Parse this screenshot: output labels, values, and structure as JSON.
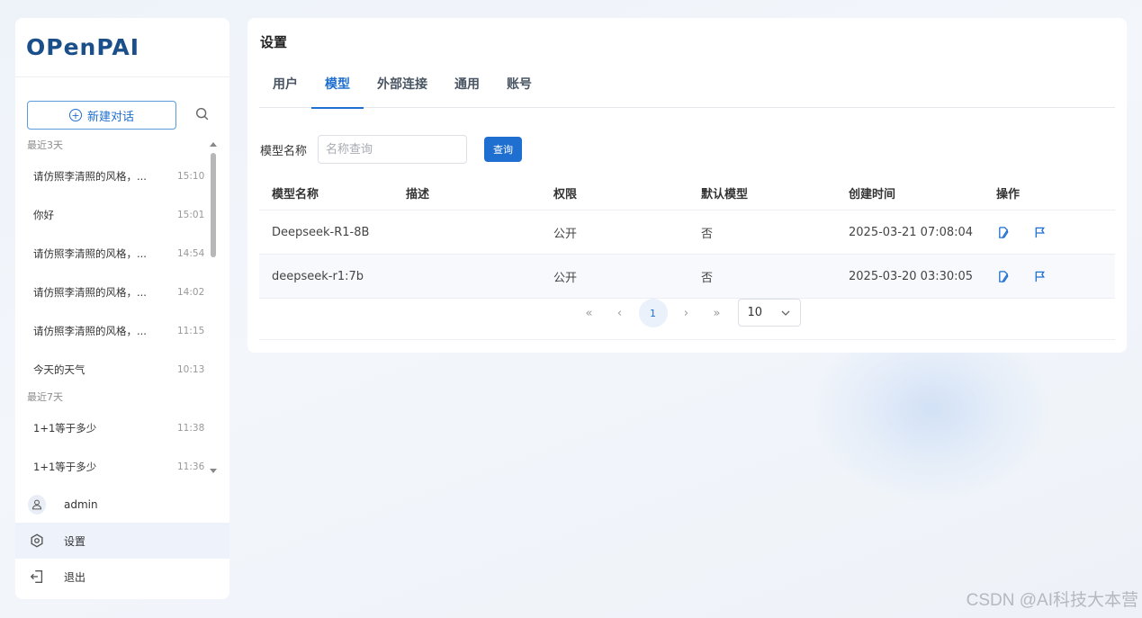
{
  "sidebar": {
    "logo": "OPenPAI",
    "new_chat_label": "新建对话",
    "groups": [
      {
        "title": "最近3天",
        "items": [
          {
            "text": "请仿照李清照的风格，...",
            "time": "15:10"
          },
          {
            "text": "你好",
            "time": "15:01"
          },
          {
            "text": "请仿照李清照的风格，...",
            "time": "14:54"
          },
          {
            "text": "请仿照李清照的风格，...",
            "time": "14:02"
          },
          {
            "text": "请仿照李清照的风格，...",
            "time": "11:15"
          },
          {
            "text": "今天的天气",
            "time": "10:13"
          }
        ]
      },
      {
        "title": "最近7天",
        "items": [
          {
            "text": "1+1等于多少",
            "time": "11:38"
          },
          {
            "text": "1+1等于多少",
            "time": "11:36"
          }
        ]
      }
    ],
    "menu": {
      "user": "admin",
      "settings": "设置",
      "logout": "退出"
    }
  },
  "main": {
    "title": "设置",
    "tabs": [
      "用户",
      "模型",
      "外部连接",
      "通用",
      "账号"
    ],
    "active_tab": "模型",
    "filter": {
      "label": "模型名称",
      "placeholder": "名称查询",
      "query_button": "查询"
    },
    "table": {
      "columns": [
        "模型名称",
        "描述",
        "权限",
        "默认模型",
        "创建时间",
        "操作"
      ],
      "rows": [
        {
          "name": "Deepseek-R1-8B",
          "desc": "",
          "permission": "公开",
          "default": "否",
          "created": "2025-03-21 07:08:04"
        },
        {
          "name": "deepseek-r1:7b",
          "desc": "",
          "permission": "公开",
          "default": "否",
          "created": "2025-03-20 03:30:05"
        }
      ]
    },
    "pagination": {
      "first": "«",
      "prev": "‹",
      "current": "1",
      "next": "›",
      "last": "»",
      "page_size": "10"
    }
  },
  "watermark": "CSDN @AI科技大本营",
  "colors": {
    "accent": "#1f6fd0",
    "logo": "#1a4f8a"
  }
}
